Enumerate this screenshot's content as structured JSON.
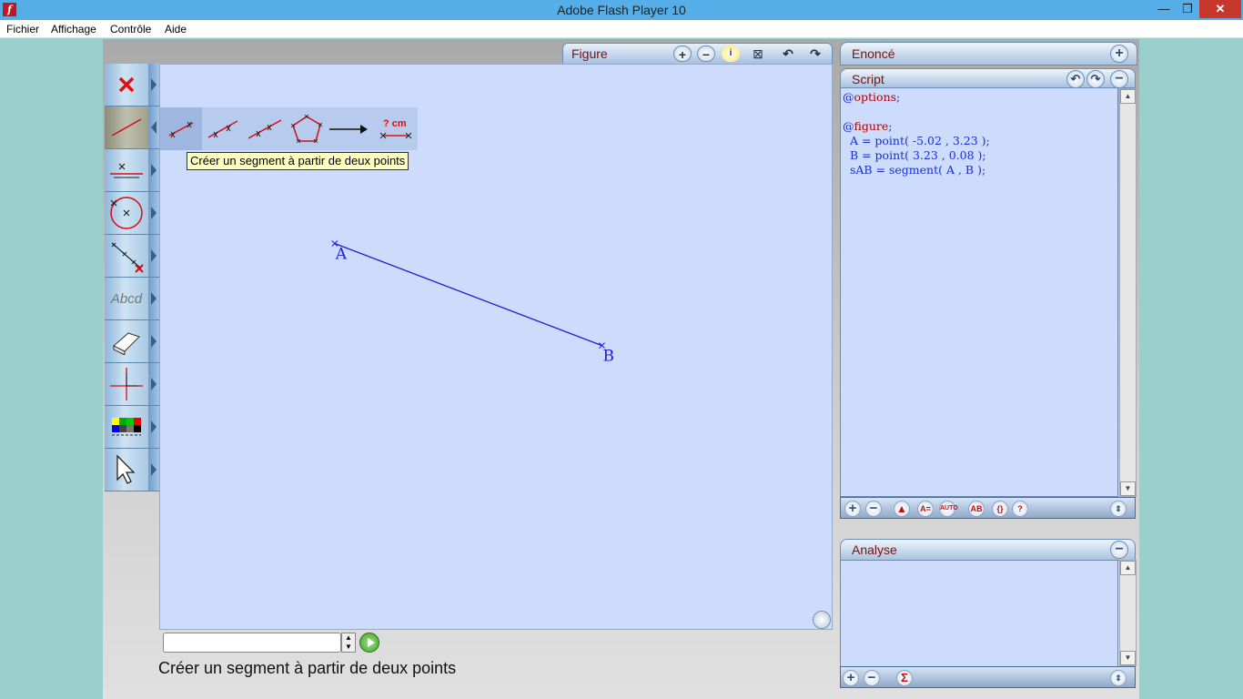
{
  "window": {
    "title": "Adobe Flash Player 10",
    "app_icon": "f",
    "minimize": "—",
    "maximize": "❐",
    "close": "✕"
  },
  "menu": [
    "Fichier",
    "Affichage",
    "Contrôle",
    "Aide"
  ],
  "figure": {
    "tab_label": "Figure",
    "points": [
      {
        "label": "A",
        "x": -5.02,
        "y": 3.23
      },
      {
        "label": "B",
        "x": 3.23,
        "y": 0.08
      }
    ],
    "segment": {
      "name": "sAB",
      "from": "A",
      "to": "B",
      "color": "#1a1adc"
    }
  },
  "segment_menu": {
    "options": [
      "segment-two-points",
      "half-line",
      "line",
      "polygon",
      "vector",
      "segment-length"
    ],
    "length_label": "? cm"
  },
  "tooltip": "Créer un segment à partir de deux points",
  "status": "Créer un segment à partir de deux points",
  "command_input": {
    "value": ""
  },
  "toolbar": {
    "tools": [
      "delete",
      "segment",
      "line",
      "circle",
      "points-on-line",
      "text",
      "eraser",
      "axes",
      "colors",
      "pointer"
    ],
    "text_tool_label": "Abcd"
  },
  "panels": {
    "enonce": {
      "title": "Enoncé"
    },
    "script": {
      "title": "Script",
      "lines": [
        {
          "kw": "@options",
          "rest": ";"
        },
        {
          "kw": "",
          "rest": ""
        },
        {
          "kw": "@figure",
          "rest": ";"
        },
        {
          "kw": "",
          "rest": "  A = point( -5.02 , 3.23 );"
        },
        {
          "kw": "",
          "rest": "  B = point( 3.23 , 0.08 );"
        },
        {
          "kw": "",
          "rest": "  sAB = segment( A , B );"
        }
      ]
    },
    "analyse": {
      "title": "Analyse"
    }
  },
  "colors": {
    "accent": "#7a1010",
    "canvas": "#cddcfc",
    "script_text": "#1a2fd0"
  }
}
